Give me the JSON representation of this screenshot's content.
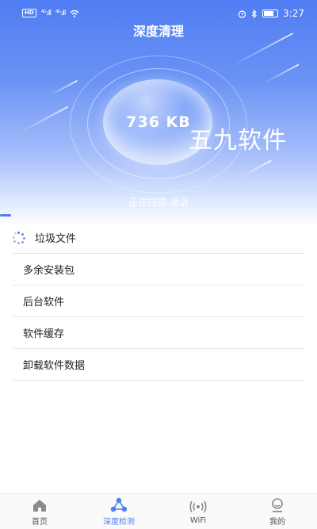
{
  "status_bar": {
    "left_badge": "HD",
    "signal1": "⁴ᴳ.ıll",
    "signal2": "⁴ᴳ.ıll",
    "wifi": "wifi-icon",
    "alarm": "alarm-icon",
    "bluetooth": "bluetooth-icon",
    "time": "3:27"
  },
  "header": {
    "title": "深度清理"
  },
  "scan_result": {
    "size": "736 KB",
    "status": "正在扫描:通话"
  },
  "watermark": "五九软件",
  "list": {
    "items": [
      {
        "label": "垃圾文件",
        "icon": "spinner-icon"
      },
      {
        "label": "多余安装包"
      },
      {
        "label": "后台软件"
      },
      {
        "label": "软件缓存"
      },
      {
        "label": "卸载软件数据"
      }
    ]
  },
  "tabs": [
    {
      "label": "首页",
      "icon": "home-icon"
    },
    {
      "label": "深度检测",
      "icon": "network-icon"
    },
    {
      "label": "WiFi",
      "icon": "wifi-signal-icon"
    },
    {
      "label": "我的",
      "icon": "user-icon"
    }
  ],
  "colors": {
    "accent": "#4f7df2",
    "hero_top": "#4f7df2",
    "hero_bottom": "#ffffff"
  }
}
